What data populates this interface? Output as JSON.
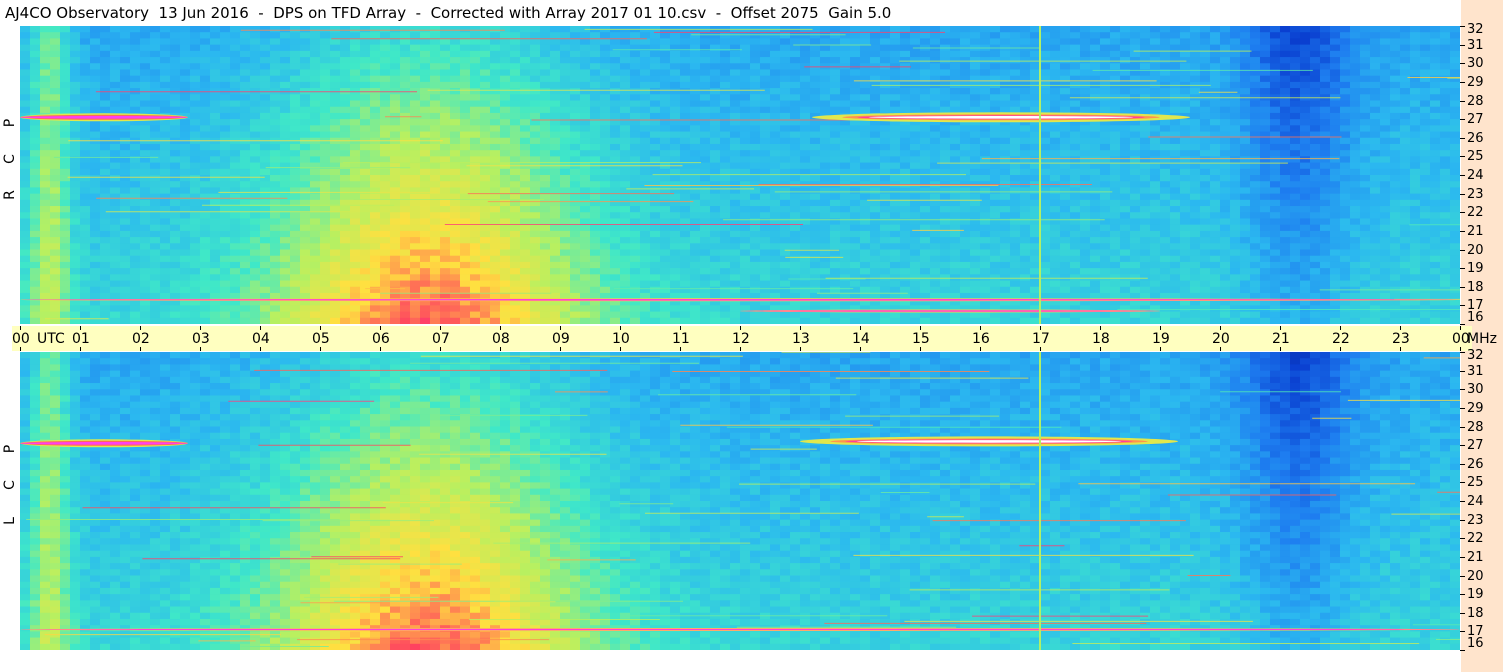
{
  "header": {
    "title": "AJ4CO Observatory  13 Jun 2016  -  DPS on TFD Array  -  Corrected with Array 2017 01 10.csv  -  Offset 2075  Gain 5.0"
  },
  "chart_data": [
    {
      "type": "heatmap",
      "panel": "upper",
      "polarization_label": [
        "R",
        "C",
        "P"
      ],
      "x_axis": {
        "unit_label": "UTC",
        "ticks": [
          "00",
          "01",
          "02",
          "03",
          "04",
          "05",
          "06",
          "07",
          "08",
          "09",
          "10",
          "11",
          "12",
          "13",
          "14",
          "15",
          "16",
          "17",
          "18",
          "19",
          "20",
          "21",
          "22",
          "23",
          "00"
        ],
        "range": [
          0,
          24
        ]
      },
      "y_axis": {
        "unit_label": "MHz",
        "ticks": [
          "16",
          "17",
          "18",
          "19",
          "20",
          "21",
          "22",
          "23",
          "24",
          "25",
          "26",
          "27",
          "28",
          "29",
          "30",
          "31",
          "32"
        ],
        "range": [
          16,
          32
        ]
      },
      "colorscale": [
        "#001a7a",
        "#0a3fd0",
        "#1e7ef0",
        "#2bb8f0",
        "#3fe8c8",
        "#b8f060",
        "#ffe040",
        "#ff4060",
        "#ff40ff",
        "#ffffff"
      ],
      "features": [
        {
          "freq_mhz": 27.1,
          "utc_start": 0.0,
          "utc_end": 2.8,
          "level": "very high"
        },
        {
          "freq_mhz": 27.1,
          "utc_start": 13.2,
          "utc_end": 19.5,
          "level": "saturated"
        },
        {
          "freq_mhz": 17.3,
          "utc_start": 0.0,
          "utc_end": 24.0,
          "level": "high"
        },
        {
          "freq_mhz": 16.7,
          "utc_start": 12.0,
          "utc_end": 19.0,
          "level": "high"
        },
        {
          "freq_mhz": 17.05,
          "utc_start": 17.0,
          "utc_end": 17.1,
          "level": "high",
          "note": "vertical line"
        }
      ]
    },
    {
      "type": "heatmap",
      "panel": "lower",
      "polarization_label": [
        "L",
        "C",
        "P"
      ],
      "x_axis": {
        "unit_label": "UTC",
        "ticks": [
          "00",
          "01",
          "02",
          "03",
          "04",
          "05",
          "06",
          "07",
          "08",
          "09",
          "10",
          "11",
          "12",
          "13",
          "14",
          "15",
          "16",
          "17",
          "18",
          "19",
          "20",
          "21",
          "22",
          "23",
          "00"
        ],
        "range": [
          0,
          24
        ]
      },
      "y_axis": {
        "unit_label": "MHz",
        "ticks": [
          "16",
          "17",
          "18",
          "19",
          "20",
          "21",
          "22",
          "23",
          "24",
          "25",
          "26",
          "27",
          "28",
          "29",
          "30",
          "31",
          "32"
        ],
        "range": [
          16,
          32
        ]
      },
      "colorscale": [
        "#001a7a",
        "#0a3fd0",
        "#1e7ef0",
        "#2bb8f0",
        "#3fe8c8",
        "#b8f060",
        "#ffe040",
        "#ff4060",
        "#ff40ff",
        "#ffffff"
      ],
      "features": [
        {
          "freq_mhz": 27.1,
          "utc_start": 0.0,
          "utc_end": 2.8,
          "level": "very high"
        },
        {
          "freq_mhz": 27.2,
          "utc_start": 13.0,
          "utc_end": 19.3,
          "level": "saturated"
        },
        {
          "freq_mhz": 17.1,
          "utc_start": 0.0,
          "utc_end": 24.0,
          "level": "high"
        },
        {
          "freq_mhz": 17.05,
          "utc_start": 17.0,
          "utc_end": 17.1,
          "level": "high",
          "note": "vertical line"
        }
      ]
    }
  ]
}
